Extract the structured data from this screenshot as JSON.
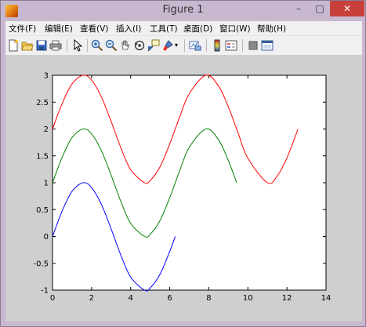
{
  "window": {
    "title": "Figure 1"
  },
  "window_controls": {
    "minimize": "–",
    "maximize": "□",
    "close": "✕"
  },
  "menu": {
    "items": [
      {
        "label": "文件(F)"
      },
      {
        "label": "编辑(E)"
      },
      {
        "label": "查看(V)"
      },
      {
        "label": "插入(I)"
      },
      {
        "label": "工具(T)"
      },
      {
        "label": "桌面(D)"
      },
      {
        "label": "窗口(W)"
      },
      {
        "label": "帮助(H)"
      }
    ]
  },
  "toolbar": {
    "icons": [
      "new-figure-icon",
      "open-file-icon",
      "save-icon",
      "print-icon",
      "pointer-icon",
      "zoom-in-icon",
      "zoom-out-icon",
      "pan-icon",
      "rotate-icon",
      "data-cursor-icon",
      "brush-icon",
      "brush-dropdown-icon",
      "link-plot-icon",
      "colorbar-icon",
      "legend-icon",
      "hide-plot-tools-icon",
      "show-plot-tools-icon"
    ]
  },
  "colors": {
    "red_series": "#ff0000",
    "green_series": "#008000",
    "blue_series": "#0000ff",
    "figure_bg": "#cfcfcf",
    "axes_bg": "#ffffff"
  },
  "chart_data": {
    "type": "line",
    "xlim": [
      0,
      14
    ],
    "ylim": [
      -1,
      3
    ],
    "x_ticks": [
      "0",
      "2",
      "4",
      "6",
      "8",
      "10",
      "12",
      "14"
    ],
    "y_ticks": [
      "-1",
      "-0.5",
      "0",
      "0.5",
      "1",
      "1.5",
      "2",
      "2.5",
      "3"
    ],
    "grid": false,
    "series": [
      {
        "color": "#0000ff",
        "x": [
          0,
          0.5,
          1.0,
          1.5708,
          2.0,
          2.5,
          3.0,
          3.5,
          4.0,
          4.7124,
          5.0,
          5.5,
          6.0,
          6.2832
        ],
        "y": [
          0,
          0.479,
          0.841,
          1.0,
          0.909,
          0.598,
          0.141,
          -0.351,
          -0.757,
          -1.0,
          -0.959,
          -0.706,
          -0.279,
          0
        ]
      },
      {
        "color": "#008000",
        "x": [
          0,
          0.5,
          1.0,
          1.5708,
          2.0,
          2.5,
          3.0,
          3.5,
          4.0,
          4.7124,
          5.0,
          5.5,
          6.0,
          6.5,
          7.0,
          7.854,
          8.5,
          9.0,
          9.4248
        ],
        "y": [
          1,
          1.479,
          1.841,
          2.0,
          1.909,
          1.598,
          1.141,
          0.649,
          0.243,
          0.0,
          0.041,
          0.294,
          0.721,
          1.215,
          1.657,
          2.0,
          1.798,
          1.412,
          1.0
        ]
      },
      {
        "color": "#ff0000",
        "x": [
          0,
          0.5,
          1.0,
          1.5708,
          2.0,
          2.5,
          3.0,
          3.5,
          4.0,
          4.7124,
          5.0,
          5.5,
          6.0,
          6.5,
          7.0,
          7.854,
          8.5,
          9.0,
          9.5,
          10.0,
          10.9956,
          11.5,
          12.0,
          12.5664
        ],
        "y": [
          2,
          2.479,
          2.841,
          3.0,
          2.909,
          2.598,
          2.141,
          1.649,
          1.243,
          1.0,
          1.041,
          1.294,
          1.721,
          2.215,
          2.657,
          3.0,
          2.798,
          2.412,
          1.925,
          1.456,
          1.0,
          1.125,
          1.463,
          2.0
        ]
      }
    ]
  }
}
